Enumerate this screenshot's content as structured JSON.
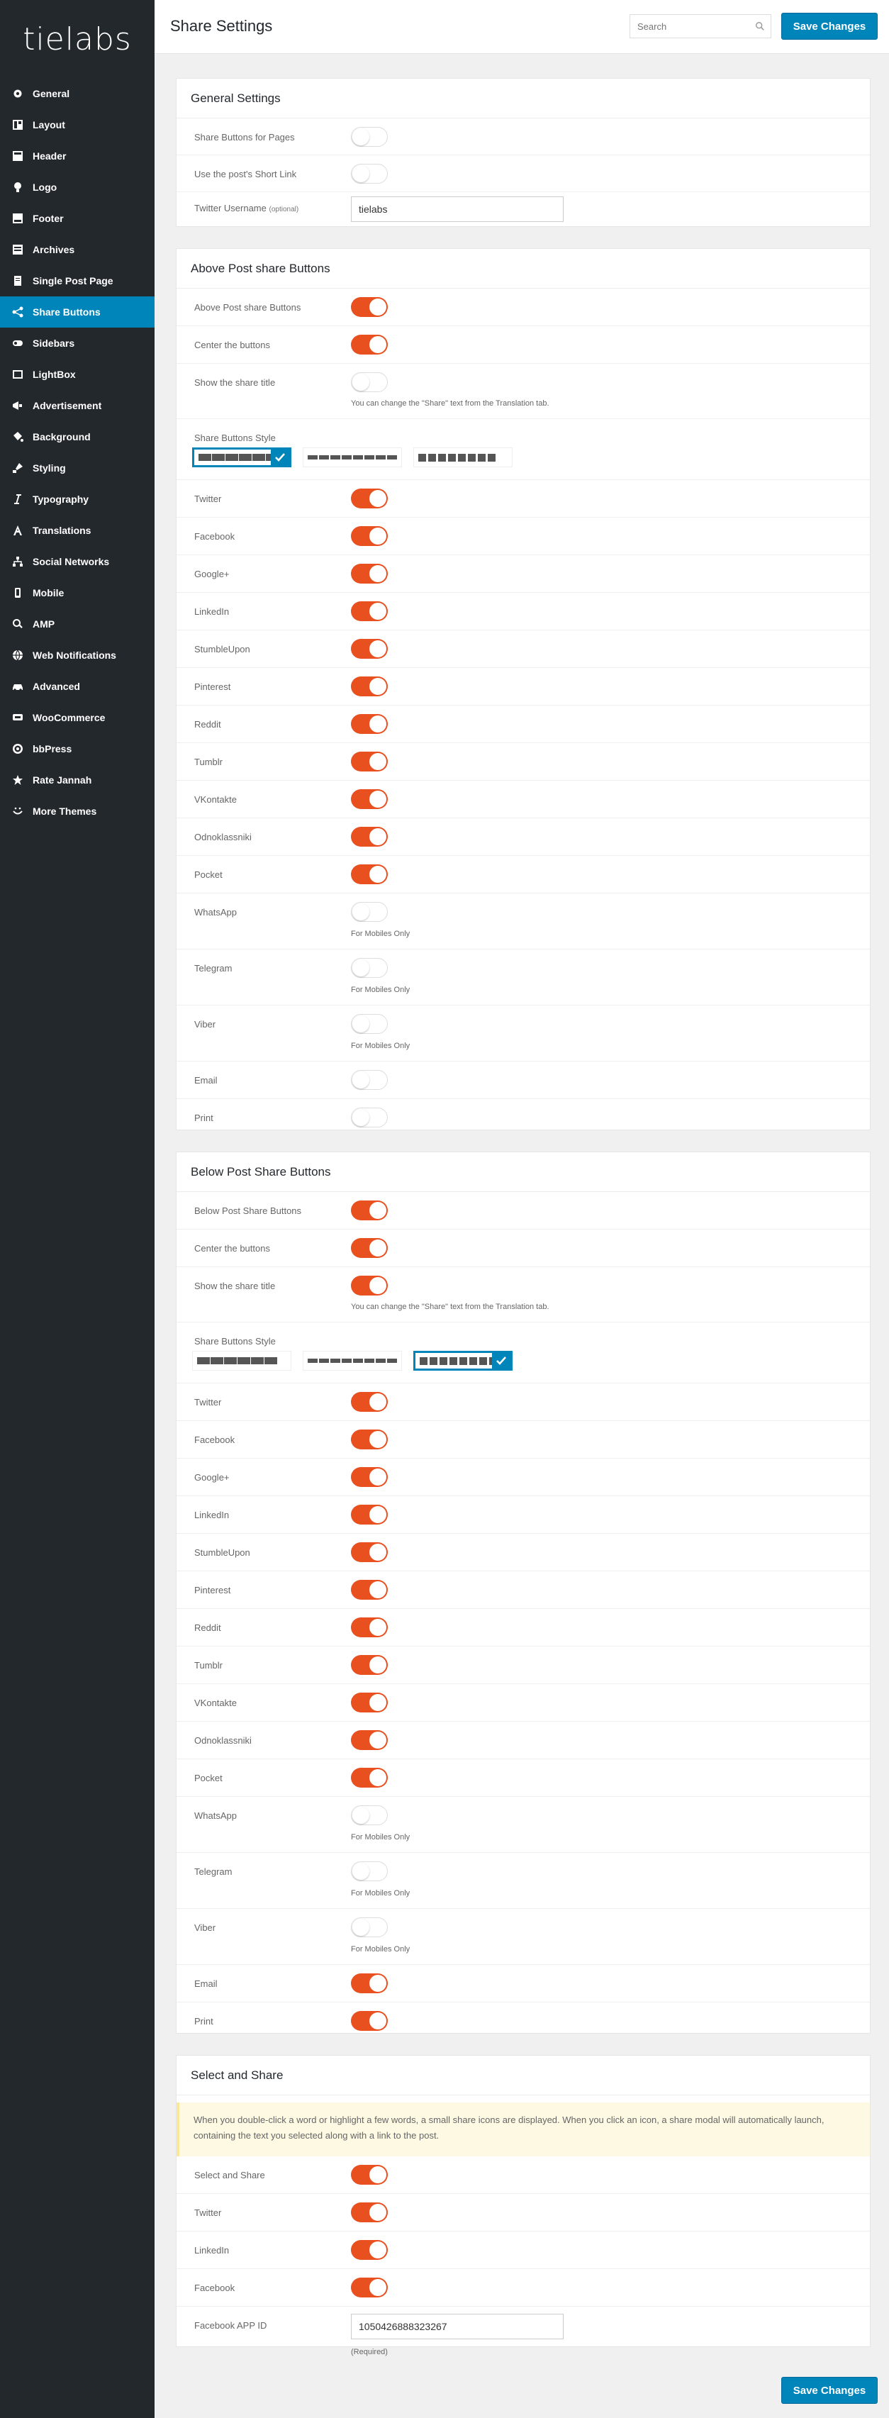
{
  "logo": "tielabs",
  "sidebar": {
    "items": [
      {
        "label": "General",
        "icon": "gear-icon"
      },
      {
        "label": "Layout",
        "icon": "layout-icon"
      },
      {
        "label": "Header",
        "icon": "header-icon"
      },
      {
        "label": "Logo",
        "icon": "bulb-icon"
      },
      {
        "label": "Footer",
        "icon": "footer-icon"
      },
      {
        "label": "Archives",
        "icon": "archive-icon"
      },
      {
        "label": "Single Post Page",
        "icon": "document-icon"
      },
      {
        "label": "Share Buttons",
        "icon": "share-icon",
        "active": true
      },
      {
        "label": "Sidebars",
        "icon": "sidebar-icon"
      },
      {
        "label": "LightBox",
        "icon": "lightbox-icon"
      },
      {
        "label": "Advertisement",
        "icon": "megaphone-icon"
      },
      {
        "label": "Background",
        "icon": "paint-bucket-icon"
      },
      {
        "label": "Styling",
        "icon": "brush-icon"
      },
      {
        "label": "Typography",
        "icon": "italic-icon"
      },
      {
        "label": "Translations",
        "icon": "translate-icon"
      },
      {
        "label": "Social Networks",
        "icon": "network-icon"
      },
      {
        "label": "Mobile",
        "icon": "mobile-icon"
      },
      {
        "label": "AMP",
        "icon": "search-icon"
      },
      {
        "label": "Web Notifications",
        "icon": "globe-icon"
      },
      {
        "label": "Advanced",
        "icon": "car-icon"
      },
      {
        "label": "WooCommerce",
        "icon": "woocommerce-icon"
      },
      {
        "label": "bbPress",
        "icon": "bbpress-icon"
      },
      {
        "label": "Rate Jannah",
        "icon": "star-icon"
      },
      {
        "label": "More Themes",
        "icon": "smile-icon"
      }
    ]
  },
  "header": {
    "title": "Share Settings",
    "search_placeholder": "Search",
    "save_label": "Save Changes"
  },
  "general": {
    "title": "General Settings",
    "share_pages": "Share Buttons for Pages",
    "short_link": "Use the post's Short Link",
    "twitter_username": "Twitter Username",
    "optional": "(optional)",
    "twitter_value": "tielabs"
  },
  "above": {
    "title": "Above Post share Buttons",
    "enable_label": "Above Post share Buttons",
    "center_label": "Center the buttons",
    "show_title_label": "Show the share title",
    "show_title_help": "You can change the \"Share\" text from the Translation tab.",
    "style_label": "Share Buttons Style",
    "style_selected": 1,
    "networks": [
      {
        "label": "Twitter",
        "on": true
      },
      {
        "label": "Facebook",
        "on": true
      },
      {
        "label": "Google+",
        "on": true
      },
      {
        "label": "LinkedIn",
        "on": true
      },
      {
        "label": "StumbleUpon",
        "on": true
      },
      {
        "label": "Pinterest",
        "on": true
      },
      {
        "label": "Reddit",
        "on": true
      },
      {
        "label": "Tumblr",
        "on": true
      },
      {
        "label": "VKontakte",
        "on": true
      },
      {
        "label": "Odnoklassniki",
        "on": true
      },
      {
        "label": "Pocket",
        "on": true
      },
      {
        "label": "WhatsApp",
        "on": false,
        "help": "For Mobiles Only"
      },
      {
        "label": "Telegram",
        "on": false,
        "help": "For Mobiles Only"
      },
      {
        "label": "Viber",
        "on": false,
        "help": "For Mobiles Only"
      },
      {
        "label": "Email",
        "on": false
      },
      {
        "label": "Print",
        "on": false
      }
    ]
  },
  "below": {
    "title": "Below Post Share Buttons",
    "enable_label": "Below Post Share Buttons",
    "center_label": "Center the buttons",
    "show_title_label": "Show the share title",
    "show_title_help": "You can change the \"Share\" text from the Translation tab.",
    "style_label": "Share Buttons Style",
    "style_selected": 3,
    "networks": [
      {
        "label": "Twitter",
        "on": true
      },
      {
        "label": "Facebook",
        "on": true
      },
      {
        "label": "Google+",
        "on": true
      },
      {
        "label": "LinkedIn",
        "on": true
      },
      {
        "label": "StumbleUpon",
        "on": true
      },
      {
        "label": "Pinterest",
        "on": true
      },
      {
        "label": "Reddit",
        "on": true
      },
      {
        "label": "Tumblr",
        "on": true
      },
      {
        "label": "VKontakte",
        "on": true
      },
      {
        "label": "Odnoklassniki",
        "on": true
      },
      {
        "label": "Pocket",
        "on": true
      },
      {
        "label": "WhatsApp",
        "on": false,
        "help": "For Mobiles Only"
      },
      {
        "label": "Telegram",
        "on": false,
        "help": "For Mobiles Only"
      },
      {
        "label": "Viber",
        "on": false,
        "help": "For Mobiles Only"
      },
      {
        "label": "Email",
        "on": true
      },
      {
        "label": "Print",
        "on": true
      }
    ]
  },
  "select_share": {
    "title": "Select and Share",
    "notice": "When you double-click a word or highlight a few words, a small share icons are displayed. When you click an icon, a share modal will automatically launch, containing the text you selected along with a link to the post.",
    "enable_label": "Select and Share",
    "twitter": "Twitter",
    "linkedin": "LinkedIn",
    "facebook": "Facebook",
    "app_id_label": "Facebook APP ID",
    "app_id_value": "1050426888323267",
    "required": "(Required)"
  },
  "colors": {
    "accent": "#0085ba",
    "toggle_on": "#e8501f",
    "sidebar_bg": "#23282d"
  }
}
